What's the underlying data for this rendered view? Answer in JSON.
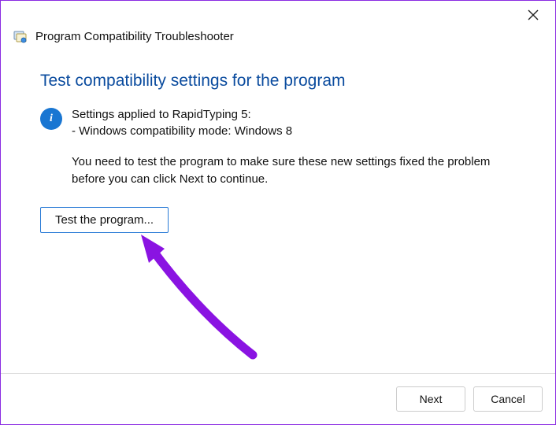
{
  "window": {
    "title": "Program Compatibility Troubleshooter"
  },
  "main": {
    "heading": "Test compatibility settings for the program",
    "info_line1": "Settings applied to RapidTyping 5:",
    "info_line2": "- Windows compatibility mode: Windows 8",
    "instruction": "You need to test the program to make sure these new settings fixed the problem before you can click Next to continue.",
    "info_icon_glyph": "i",
    "test_button_label": "Test the program..."
  },
  "footer": {
    "next_label": "Next",
    "cancel_label": "Cancel"
  },
  "annotation": {
    "arrow_color": "#8a13e2"
  }
}
